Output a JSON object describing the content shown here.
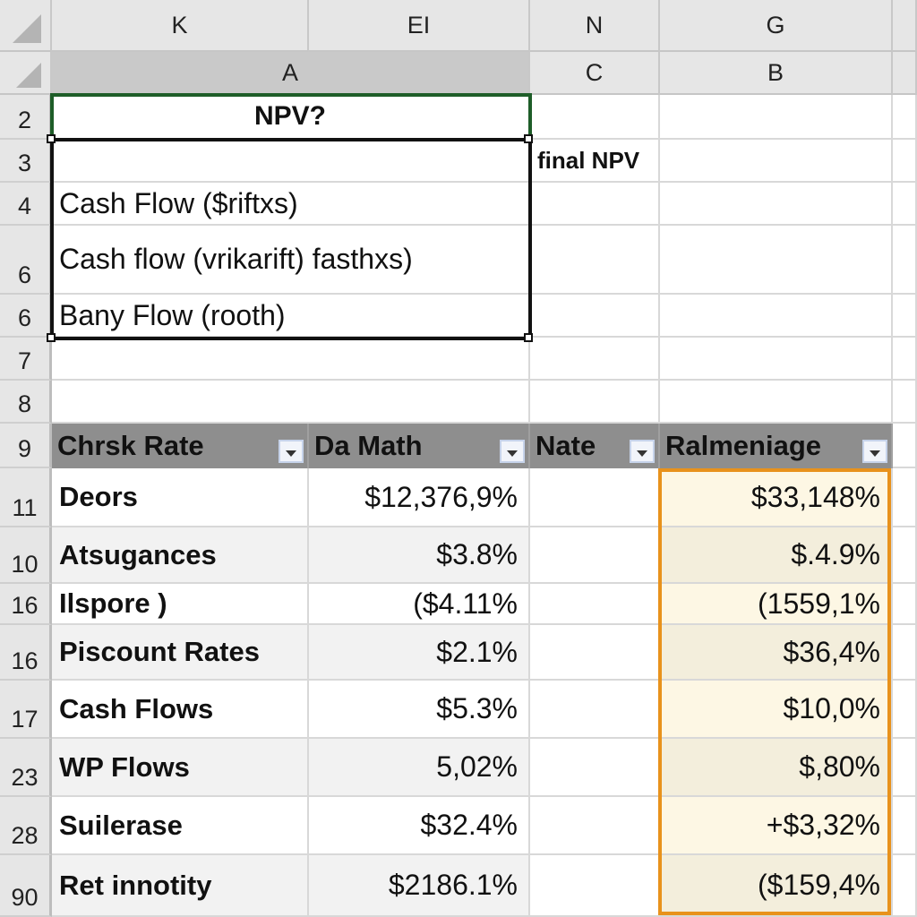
{
  "column_headers_top": [
    "K",
    "EI",
    "N",
    "G"
  ],
  "column_headers_second": [
    "A",
    "C",
    "B"
  ],
  "row_headers": [
    "2",
    "3",
    "4",
    "6",
    "6",
    "7",
    "8",
    "9",
    "11",
    "10",
    "16",
    "16",
    "17",
    "23",
    "28",
    "90"
  ],
  "top_block": {
    "title": "NPV?",
    "side_label": "final NPV",
    "lines": [
      "",
      "Cash Flow ($riftxs)",
      "Cash flow (vrikarift) fasthxs)",
      "Bany Flow (rooth)"
    ]
  },
  "table": {
    "headers": [
      "Chrsk Rate",
      "Da Math",
      "Nate",
      "Ralmeniage"
    ],
    "rows": [
      {
        "label": "Deors",
        "da_math": "$12,376,9%",
        "nate": "",
        "ralmeniage": "$33,148%"
      },
      {
        "label": "Atsugances",
        "da_math": "$3.8%",
        "nate": "",
        "ralmeniage": "$.4.9%"
      },
      {
        "label": "Ilspore )",
        "da_math": "($4.11%",
        "nate": "",
        "ralmeniage": "(1559,1%"
      },
      {
        "label": "Piscount Rates",
        "da_math": "$2.1%",
        "nate": "",
        "ralmeniage": "$36,4%"
      },
      {
        "label": "Cash Flows",
        "da_math": "$5.3%",
        "nate": "",
        "ralmeniage": "$10,0%"
      },
      {
        "label": "WP Flows",
        "da_math": "5,02%",
        "nate": "",
        "ralmeniage": "$,80%"
      },
      {
        "label": "Suilerase",
        "da_math": "$32.4%",
        "nate": "",
        "ralmeniage": "+$3,32%"
      },
      {
        "label": "Ret innotity",
        "da_math": "$2186.1%",
        "nate": "",
        "ralmeniage": "($159,4%"
      }
    ]
  },
  "colors": {
    "selection_green": "#1e5d28",
    "highlight_orange": "#e8921c",
    "table_header_gray": "#8e8e8e"
  }
}
